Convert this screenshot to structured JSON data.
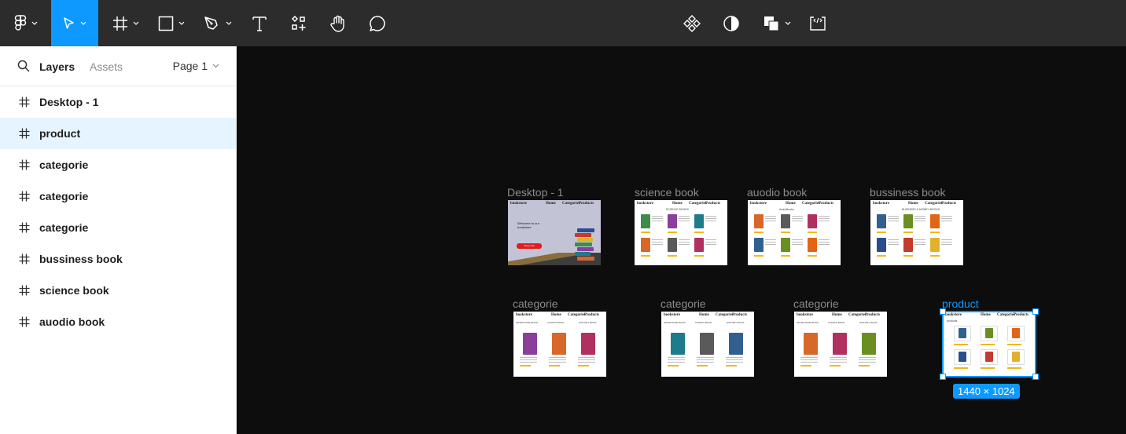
{
  "toolbar": {
    "tools": [
      {
        "name": "main-menu",
        "icon": "figma-logo-icon"
      },
      {
        "name": "move-tool",
        "icon": "pointer-icon",
        "active": true
      },
      {
        "name": "frame-tool",
        "icon": "frame-icon"
      },
      {
        "name": "shape-tool",
        "icon": "rectangle-icon"
      },
      {
        "name": "pen-tool",
        "icon": "pen-icon"
      },
      {
        "name": "text-tool",
        "icon": "text-icon"
      },
      {
        "name": "resources-tool",
        "icon": "resources-icon"
      },
      {
        "name": "hand-tool",
        "icon": "hand-icon"
      },
      {
        "name": "comment-tool",
        "icon": "comment-icon"
      },
      {
        "name": "component-tool",
        "icon": "component-icon"
      },
      {
        "name": "mask-tool",
        "icon": "contrast-icon"
      },
      {
        "name": "boolean-tool",
        "icon": "boolean-icon"
      },
      {
        "name": "dev-mode-tool",
        "icon": "code-icon"
      }
    ],
    "accent": "#0d99ff",
    "background": "#2c2c2c"
  },
  "sidebar": {
    "tabs": {
      "layers": "Layers",
      "assets": "Assets"
    },
    "page": "Page 1",
    "layers": [
      {
        "label": "Desktop - 1",
        "selected": false
      },
      {
        "label": "product",
        "selected": true
      },
      {
        "label": "categorie",
        "selected": false
      },
      {
        "label": "categorie",
        "selected": false
      },
      {
        "label": "categorie",
        "selected": false
      },
      {
        "label": "bussiness book",
        "selected": false
      },
      {
        "label": "science book",
        "selected": false
      },
      {
        "label": "auodio book",
        "selected": false
      }
    ]
  },
  "canvas": {
    "frames": [
      {
        "label": "Desktop - 1",
        "kind": "hero",
        "brand": "bookstore",
        "nav": [
          "Home",
          "Categories",
          "Products"
        ],
        "headline": "Welcome to our bookstore",
        "cta": "Shop now"
      },
      {
        "label": "science book",
        "kind": "grid",
        "brand": "bookstore",
        "nav": [
          "Home",
          "Categories",
          "Products"
        ],
        "heading": "SCIENCE BOOKS"
      },
      {
        "label": "auodio book",
        "kind": "grid",
        "brand": "bookstore",
        "nav": [
          "Home",
          "Categories",
          "Products"
        ],
        "heading": "AudioBooks"
      },
      {
        "label": "bussiness book",
        "kind": "grid",
        "brand": "bookstore",
        "nav": [
          "Home",
          "Categories",
          "Products"
        ],
        "heading": "BUSINESS & MONEY BOOKS"
      },
      {
        "label": "categorie",
        "kind": "category",
        "brand": "bookstore",
        "nav": [
          "Home",
          "Categories",
          "Products"
        ],
        "columns": [
          "ADVENTURE BOOK",
          "COMICS BOOK",
          "HISTORY BOOK"
        ]
      },
      {
        "label": "categorie",
        "kind": "category",
        "brand": "bookstore",
        "nav": [
          "Home",
          "Categories",
          "Products"
        ],
        "columns": [
          "ADVENTURE BOOK",
          "COMICS BOOK",
          "HISTORY BOOK"
        ]
      },
      {
        "label": "categorie",
        "kind": "category",
        "brand": "bookstore",
        "nav": [
          "Home",
          "Categories",
          "Products"
        ],
        "columns": [
          "ADVENTURE BOOK",
          "COMICS BOOK",
          "HISTORY BOOK"
        ]
      },
      {
        "label": "product",
        "kind": "product",
        "brand": "bookstore",
        "nav": [
          "Home",
          "Categories",
          "Products"
        ],
        "heading": "products",
        "selected": true
      }
    ],
    "selection_size": "1440 × 1024"
  }
}
